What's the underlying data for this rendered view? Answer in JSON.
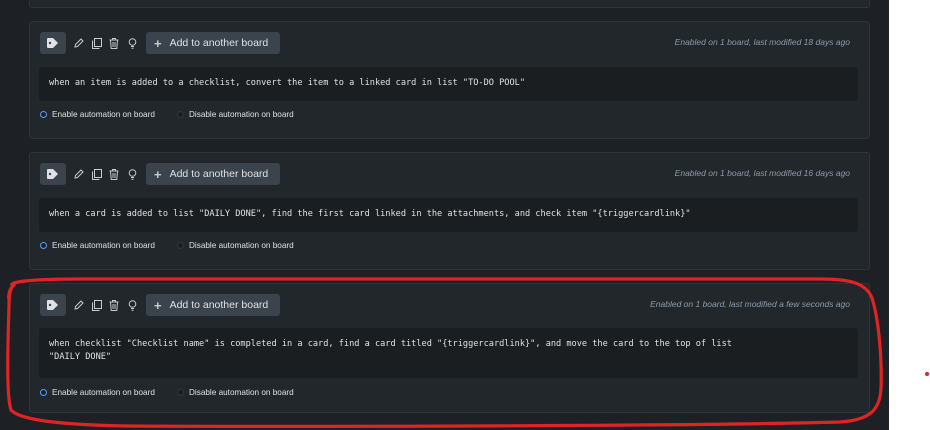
{
  "rules": [
    {
      "add_button": "Add to another board",
      "meta": "Enabled on 1 board, last modified 18 days ago",
      "text": "when an item is added to a checklist, convert the item to a linked card in list \"TO-DO POOL\"",
      "enable_label": "Enable automation on board",
      "disable_label": "Disable automation on board",
      "enabled": true
    },
    {
      "add_button": "Add to another board",
      "meta": "Enabled on 1 board, last modified 16 days ago",
      "text": "when a card is added to list \"DAILY DONE\", find the first card linked in the attachments, and check item \"{triggercardlink}\"",
      "enable_label": "Enable automation on board",
      "disable_label": "Disable automation on board",
      "enabled": true
    },
    {
      "add_button": "Add to another board",
      "meta": "Enabled on 1 board, last modified a few seconds ago",
      "text": "when checklist \"Checklist name\" is completed in a card, find a card titled \"{triggercardlink}\", and move the card to the top of list\n\"DAILY DONE\"",
      "enable_label": "Enable automation on board",
      "disable_label": "Disable automation on board",
      "enabled": true
    }
  ],
  "colors": {
    "background": "#1d2125",
    "card": "#22272b",
    "button": "#3b444c",
    "radio_accent": "#579dff",
    "annotation": "#e02424"
  },
  "icons": [
    "tag-icon",
    "edit-icon",
    "copy-icon",
    "delete-icon",
    "lightbulb-icon",
    "plus-icon"
  ]
}
